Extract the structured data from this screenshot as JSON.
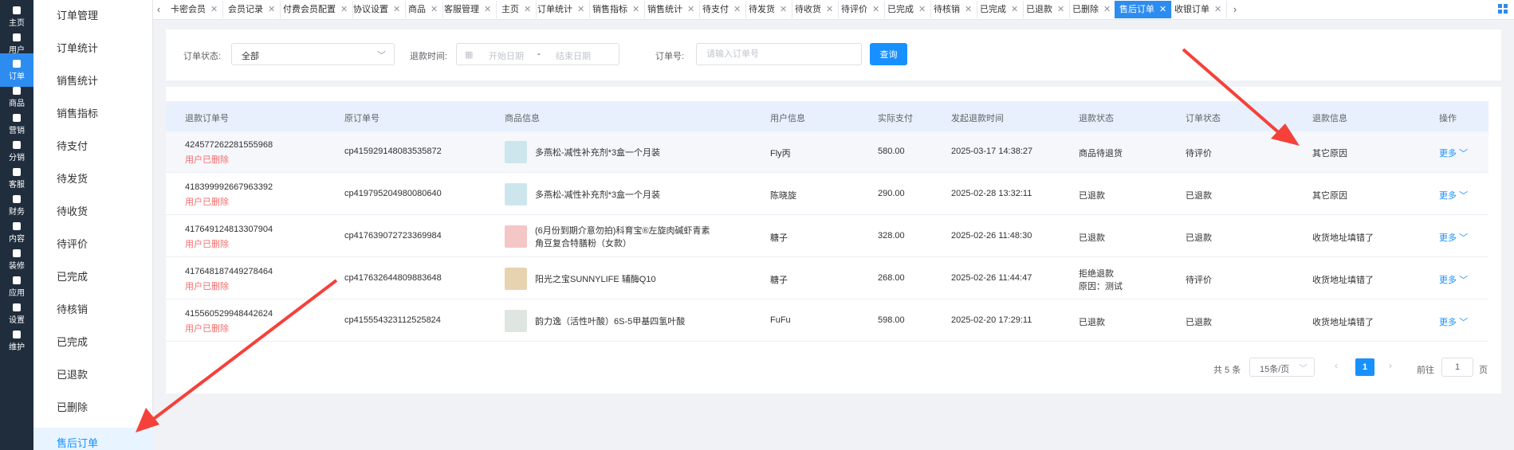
{
  "rail": [
    {
      "label": "主页",
      "icon": "home-icon"
    },
    {
      "label": "用户",
      "icon": "user-icon"
    },
    {
      "label": "订单",
      "icon": "order-icon",
      "active": true
    },
    {
      "label": "商品",
      "icon": "goods-icon"
    },
    {
      "label": "营销",
      "icon": "marketing-icon"
    },
    {
      "label": "分销",
      "icon": "distribution-icon"
    },
    {
      "label": "客服",
      "icon": "service-icon"
    },
    {
      "label": "财务",
      "icon": "finance-icon"
    },
    {
      "label": "内容",
      "icon": "content-icon"
    },
    {
      "label": "装修",
      "icon": "decorate-icon"
    },
    {
      "label": "应用",
      "icon": "apps-icon"
    },
    {
      "label": "设置",
      "icon": "settings-icon"
    },
    {
      "label": "维护",
      "icon": "maintain-icon"
    }
  ],
  "submenu": [
    "订单管理",
    "订单统计",
    "销售统计",
    "销售指标",
    "待支付",
    "待发货",
    "待收货",
    "待评价",
    "已完成",
    "待核销",
    "已完成",
    "已退款",
    "已删除",
    "售后订单"
  ],
  "tabs": [
    "卡密会员",
    "会员记录",
    "付费会员配置",
    "协议设置",
    "商品",
    "客服管理",
    "主页",
    "订单统计",
    "销售指标",
    "销售统计",
    "待支付",
    "待发货",
    "待收货",
    "待评价",
    "已完成",
    "待核销",
    "已完成",
    "已退款",
    "已删除",
    "售后订单",
    "收银订单"
  ],
  "active_tab": "售后订单",
  "filter": {
    "status_label": "订单状态:",
    "status_value": "全部",
    "refund_time_label": "退款时间:",
    "date_start_placeholder": "开始日期",
    "date_separator": "-",
    "date_end_placeholder": "结束日期",
    "order_no_label": "订单号:",
    "order_no_placeholder": "请输入订单号",
    "query_button": "查询"
  },
  "table": {
    "columns": [
      "退款订单号",
      "原订单号",
      "商品信息",
      "用户信息",
      "实际支付",
      "发起退款时间",
      "退款状态",
      "订单状态",
      "退款信息",
      "操作"
    ],
    "rows": [
      {
        "refund_no": "424577262281555968",
        "deleted": "用户已删除",
        "orig_no": "cp415929148083535872",
        "goods": "多燕松-减性补充剂*3盒一个月装",
        "goods_line2": "",
        "user": "Fly丙",
        "paid": "580.00",
        "time": "2025-03-17 14:38:27",
        "refund_status": "商品待退货",
        "refund_reason": "",
        "order_status": "待评价",
        "refund_info": "其它原因",
        "action": "更多"
      },
      {
        "refund_no": "418399992667963392",
        "deleted": "用户已删除",
        "orig_no": "cp419795204980080640",
        "goods": "多燕松-减性补充剂*3盒一个月装",
        "goods_line2": "",
        "user": "陈晓旋",
        "paid": "290.00",
        "time": "2025-02-28 13:32:11",
        "refund_status": "已退款",
        "refund_reason": "",
        "order_status": "已退款",
        "refund_info": "其它原因",
        "action": "更多"
      },
      {
        "refund_no": "417649124813307904",
        "deleted": "用户已删除",
        "orig_no": "cp417639072723369984",
        "goods": "(6月份到期介意勿拍)科育宝®左旋肉碱虾青素",
        "goods_line2": "角豆复合特膳粉（女款）",
        "user": "糖子",
        "paid": "328.00",
        "time": "2025-02-26 11:48:30",
        "refund_status": "已退款",
        "refund_reason": "",
        "order_status": "已退款",
        "refund_info": "收货地址填错了",
        "action": "更多"
      },
      {
        "refund_no": "417648187449278464",
        "deleted": "用户已删除",
        "orig_no": "cp417632644809883648",
        "goods": "阳光之宝SUNNYLIFE 辅酶Q10",
        "goods_line2": "",
        "user": "糖子",
        "paid": "268.00",
        "time": "2025-02-26 11:44:47",
        "refund_status": "拒绝退款",
        "refund_reason": "原因：测试",
        "order_status": "待评价",
        "refund_info": "收货地址填错了",
        "action": "更多"
      },
      {
        "refund_no": "415560529948442624",
        "deleted": "用户已删除",
        "orig_no": "cp415554323112525824",
        "goods": "韵力逸（活性叶酸）6S-5甲基四氢叶酸",
        "goods_line2": "",
        "user": "FuFu",
        "paid": "598.00",
        "time": "2025-02-20 17:29:11",
        "refund_status": "已退款",
        "refund_reason": "",
        "order_status": "已退款",
        "refund_info": "收货地址填错了",
        "action": "更多"
      }
    ]
  },
  "pagination": {
    "total": "共 5 条",
    "page_size": "15条/页",
    "current_page": "1",
    "goto_label": "前往",
    "goto_value": "1",
    "goto_unit": "页"
  },
  "colors": {
    "accent": "#1890ff",
    "rail_bg": "#1f2d3d",
    "danger": "#f56c6c",
    "annotation": "#f5413a"
  }
}
